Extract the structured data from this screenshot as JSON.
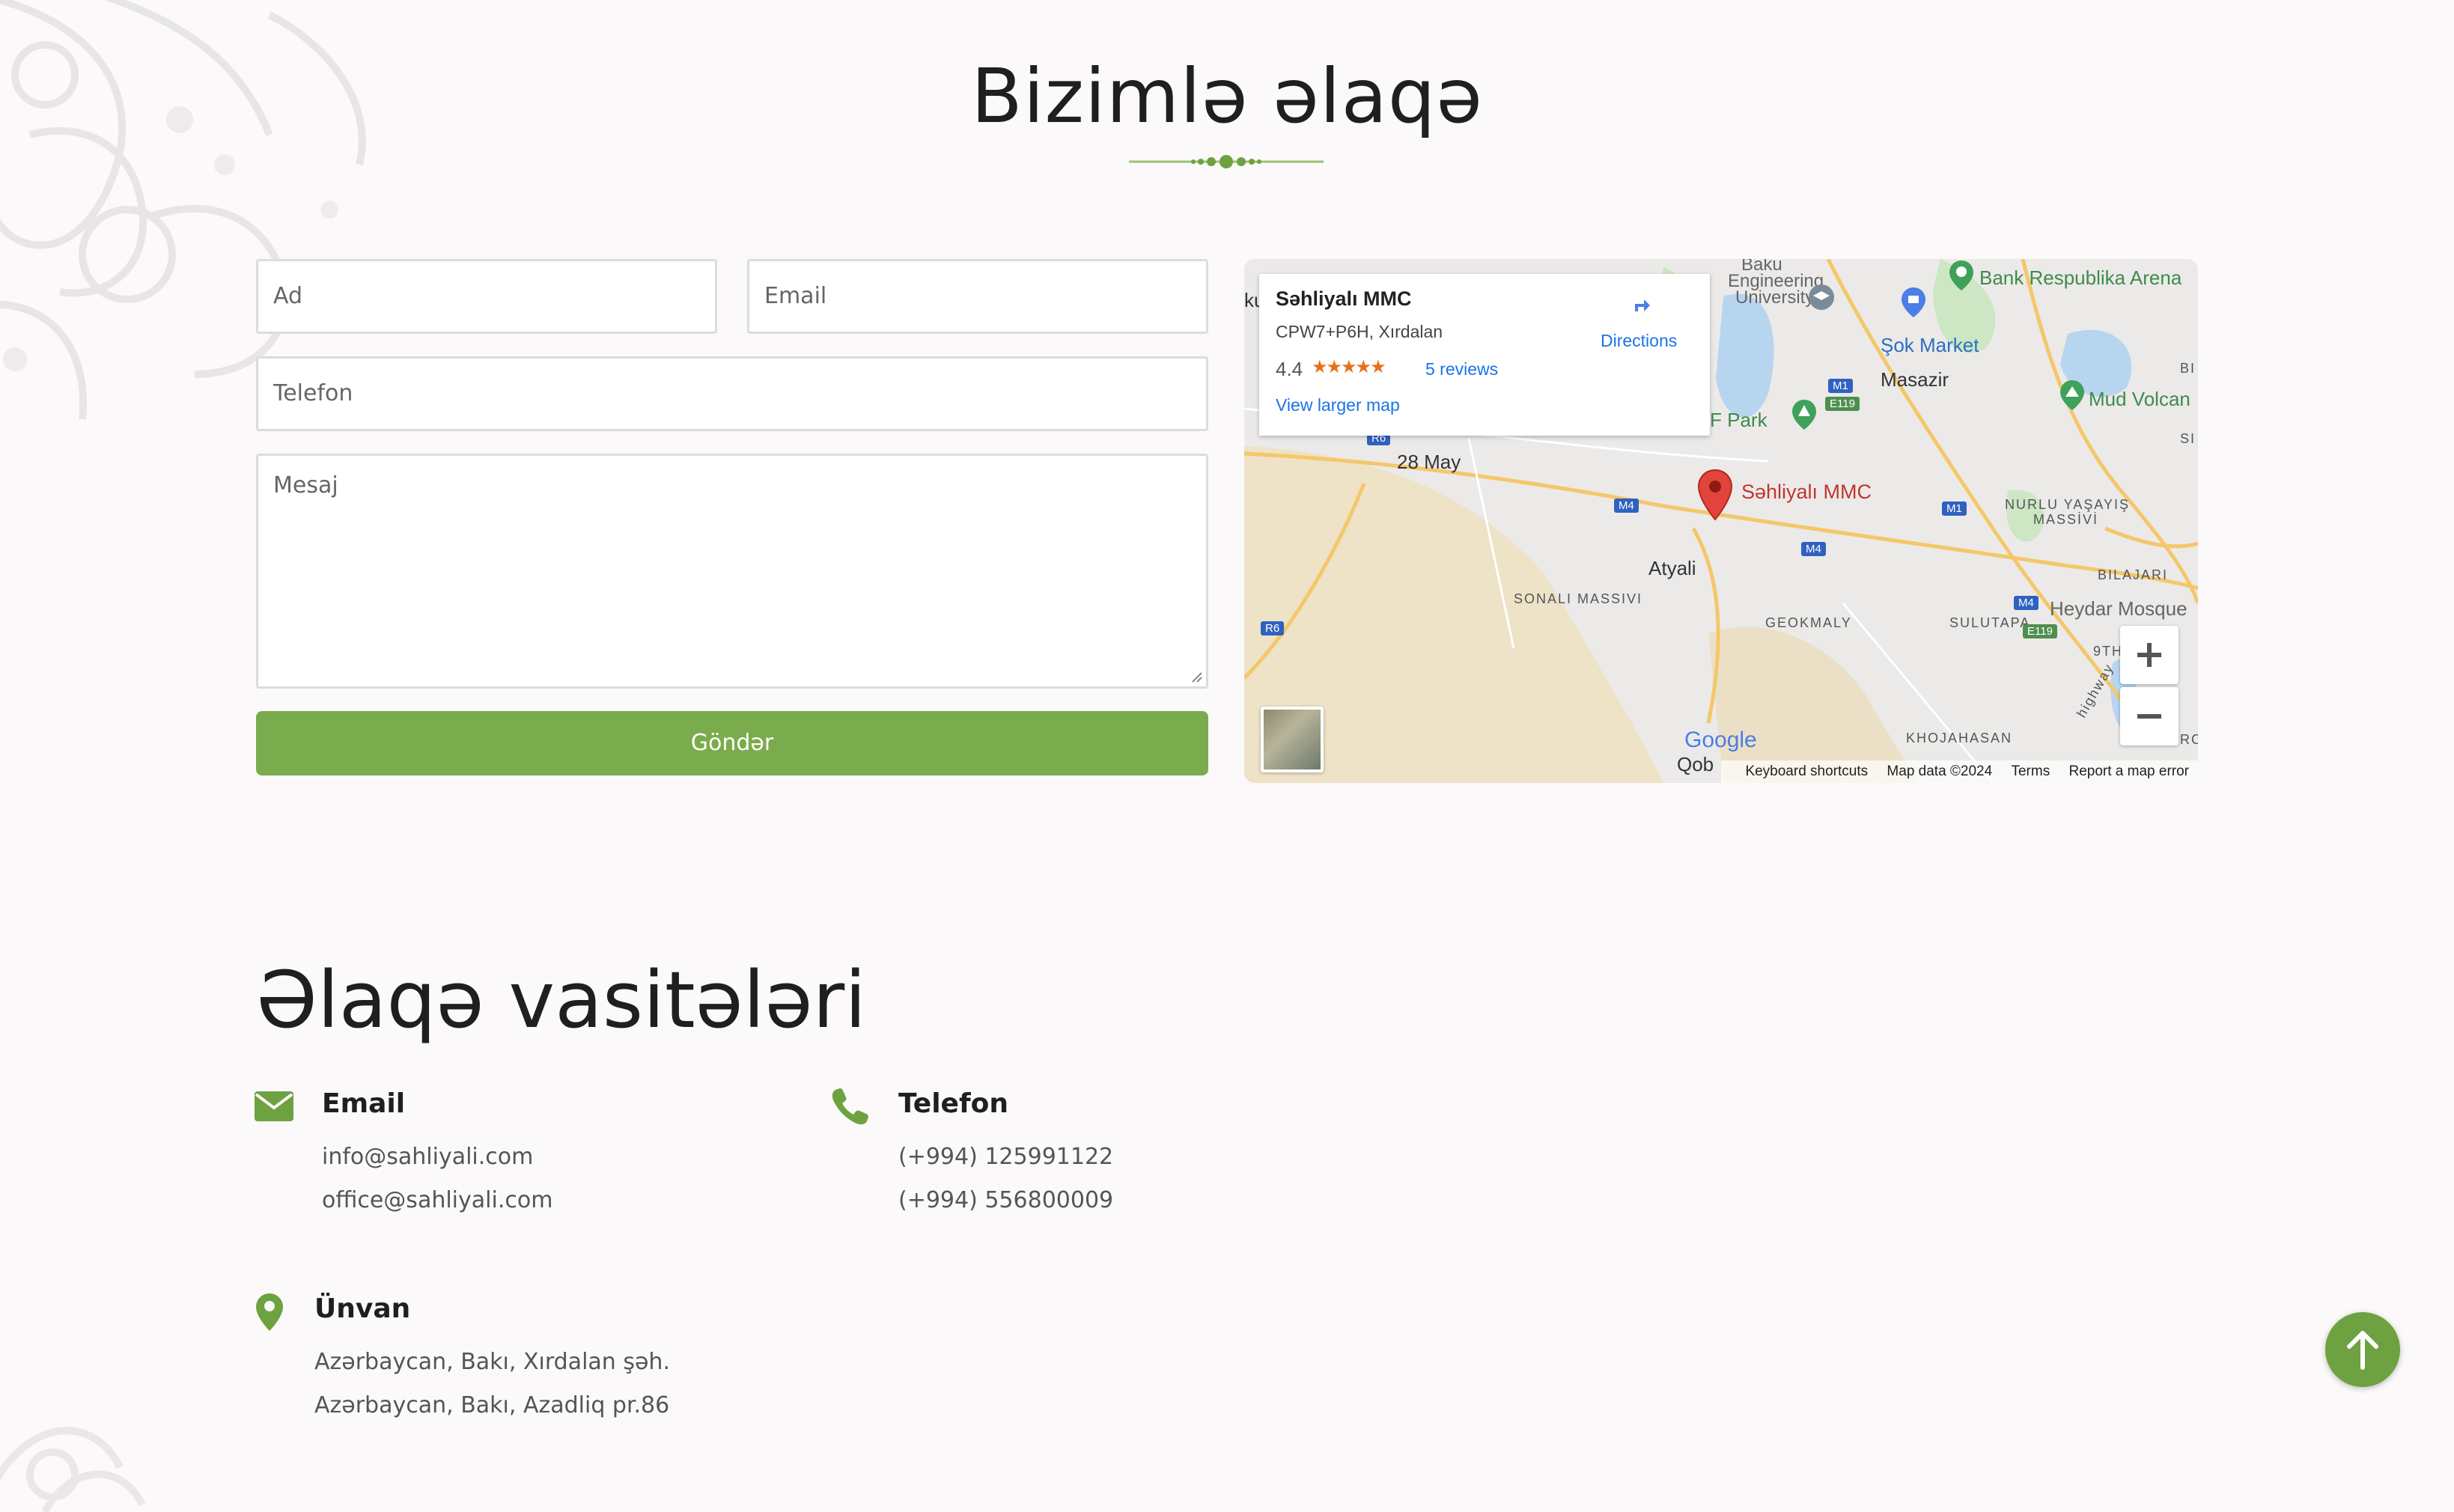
{
  "page": {
    "title": "Bizimlə əlaqə",
    "accent_color": "#7aab4c"
  },
  "form": {
    "name_placeholder": "Ad",
    "email_placeholder": "Email",
    "phone_placeholder": "Telefon",
    "message_placeholder": "Mesaj",
    "submit_label": "Göndər"
  },
  "map": {
    "place_name": "Səhliyalı MMC",
    "place_address": "CPW7+P6H, Xırdalan",
    "rating": "4.4",
    "stars_icon": "star-rating-icon",
    "reviews_link": "5 reviews",
    "view_larger": "View larger map",
    "directions": "Directions",
    "marker_label": "Səhliyalı MMC",
    "labels": {
      "may28": "28 May",
      "atyali": "Atyali",
      "sonali": "SONALI MASSIVI",
      "geokmaly": "GEOKMALY",
      "sulutapa": "SULUTAPA",
      "bilajari": "BILAJARI",
      "nurlu1": "NURLU YAŞAYIŞ",
      "nurlu2": "MASSİVİ",
      "masazir": "Masazir",
      "khojahasan": "KHOJAHASAN",
      "sok_market": "Şok Market",
      "bank_arena": "Bank Respublika Arena",
      "mud_volcano": "Mud Volcan",
      "heydar": "Heydar Mosque",
      "baku_eng1": "Baku",
      "baku_eng2": "Engineering",
      "baku_eng3": "University",
      "f_park": "F Park",
      "ku": "ku",
      "qob": "Qob",
      "ninth": "9TH",
      "highway": "highway",
      "bi": "BI",
      "si": "SI",
      "ro": "RO",
      "google": "Google"
    },
    "shields": {
      "m1a": "M1",
      "m1b": "M1",
      "e119a": "E119",
      "e119b": "E119",
      "m4a": "M4",
      "m4b": "M4",
      "m4c": "M4",
      "r6a": "R6",
      "r6b": "R6"
    },
    "footer": {
      "keyboard": "Keyboard shortcuts",
      "data": "Map data ©2024",
      "terms": "Terms",
      "report": "Report a map error"
    }
  },
  "contact": {
    "heading": "Əlaqə vasitələri",
    "email": {
      "title": "Email",
      "lines": [
        "info@sahliyali.com",
        "office@sahliyali.com"
      ]
    },
    "phone": {
      "title": "Telefon",
      "lines": [
        "(+994) 125991122",
        "(+994) 556800009"
      ]
    },
    "address": {
      "title": "Ünvan",
      "lines": [
        "Azərbaycan, Bakı, Xırdalan şəh.",
        "Azərbaycan, Bakı, Azadliq pr.86"
      ]
    }
  }
}
